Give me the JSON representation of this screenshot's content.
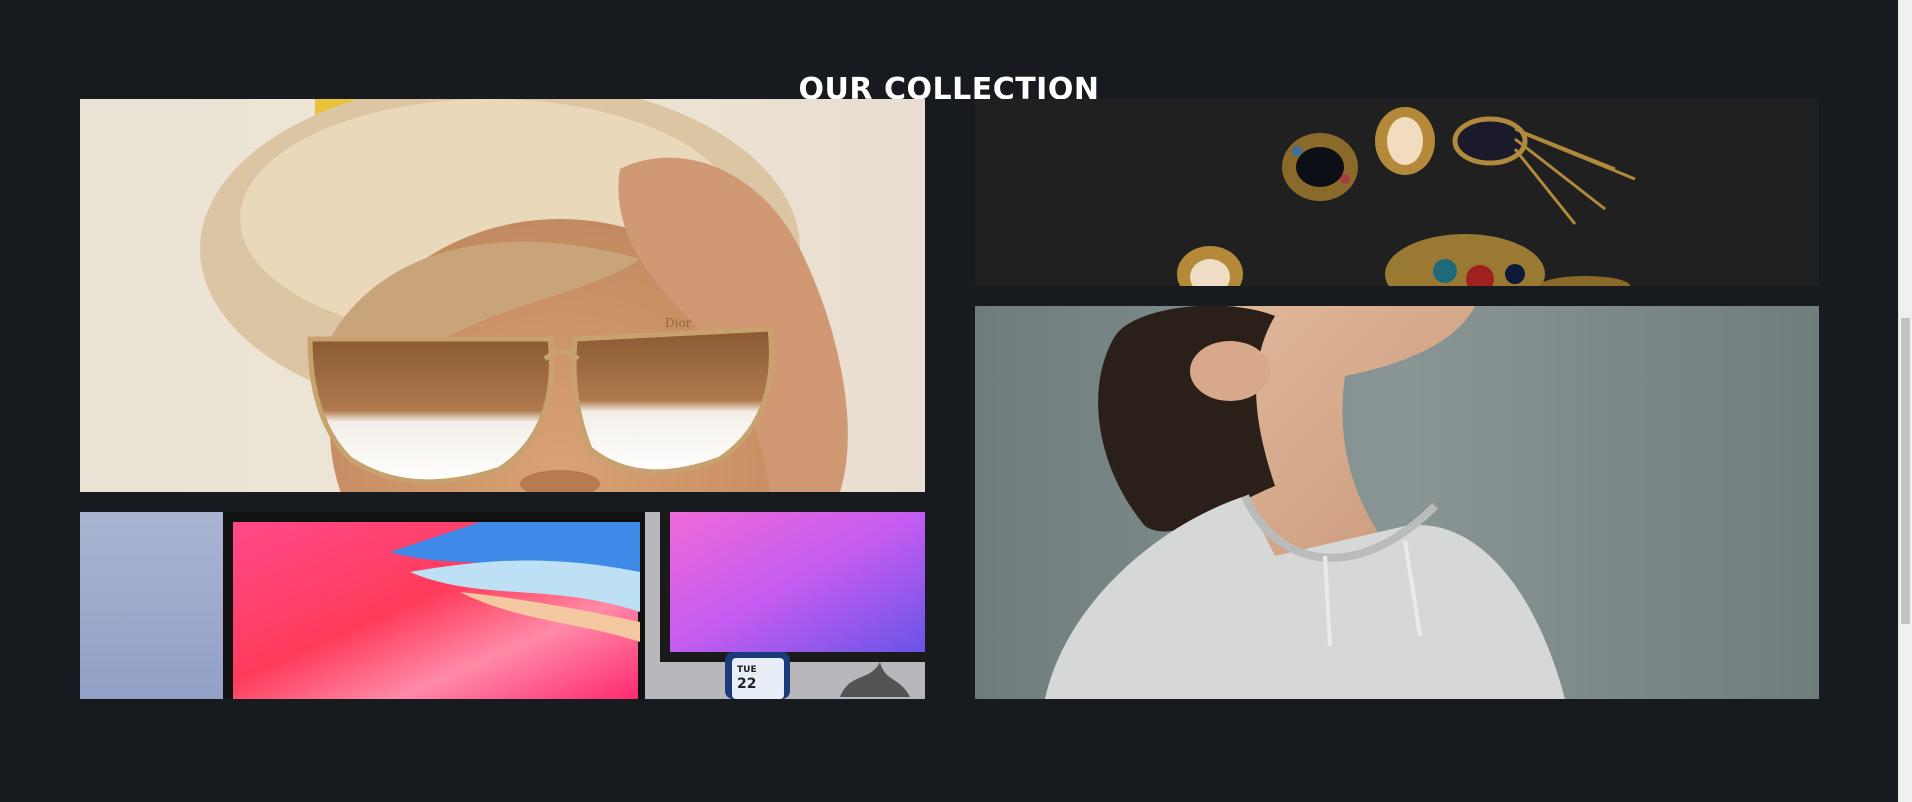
{
  "section": {
    "title": "OUR COLLECTION"
  },
  "gallery": {
    "tiles": [
      {
        "name": "sunglasses-photo",
        "alt": "Woman wearing mirrored cat-eye sunglasses and a beige beret"
      },
      {
        "name": "jewelry-photo",
        "alt": "Vintage gemstone brooches and pins on a black surface"
      },
      {
        "name": "laptop-photo",
        "alt": "Laptop and monitor showing colorful wallpapers with a phone on the desk"
      },
      {
        "name": "hoodie-photo",
        "alt": "Person with curly hair in a grey hoodie looking upward"
      }
    ],
    "phone_widget": {
      "day": "TUE",
      "date": "22"
    },
    "eyewear_brand": "Dior"
  },
  "colors": {
    "page_background": "#171b1f",
    "title_text": "#ffffff"
  }
}
